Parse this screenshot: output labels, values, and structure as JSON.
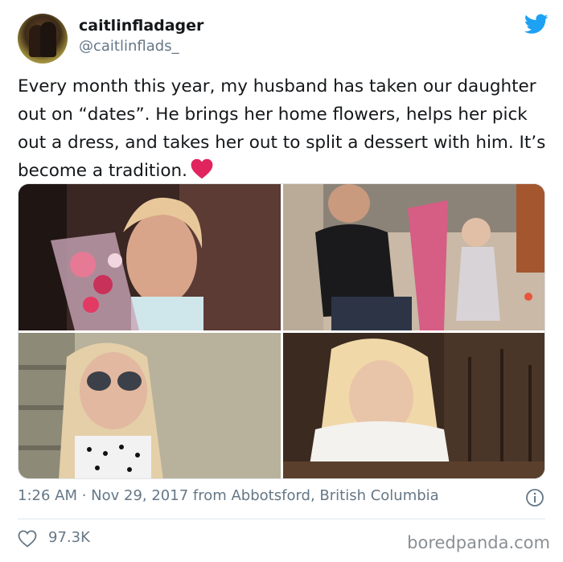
{
  "user": {
    "display_name": "caitlinfladager",
    "handle": "@caitlinflads_"
  },
  "icons": {
    "twitter": "twitter-bird-icon",
    "heart_emoji": "red-heart-icon",
    "info": "info-icon",
    "like": "heart-outline-icon"
  },
  "colors": {
    "twitter_blue": "#1da1f2",
    "heart_red": "#e0245e",
    "meta_gray": "#657786"
  },
  "tweet": {
    "text": "Every month this year, my husband has taken our daughter out on “dates”. He brings her home flowers, helps her pick out a dress, and takes her out to split a dessert with him. It’s become a tradition."
  },
  "meta": {
    "timestamp": "1:26 AM · Nov 29, 2017 from Abbotsford, British Columbia"
  },
  "stats": {
    "likes": "97.3K"
  },
  "watermark": "boredpanda.com"
}
